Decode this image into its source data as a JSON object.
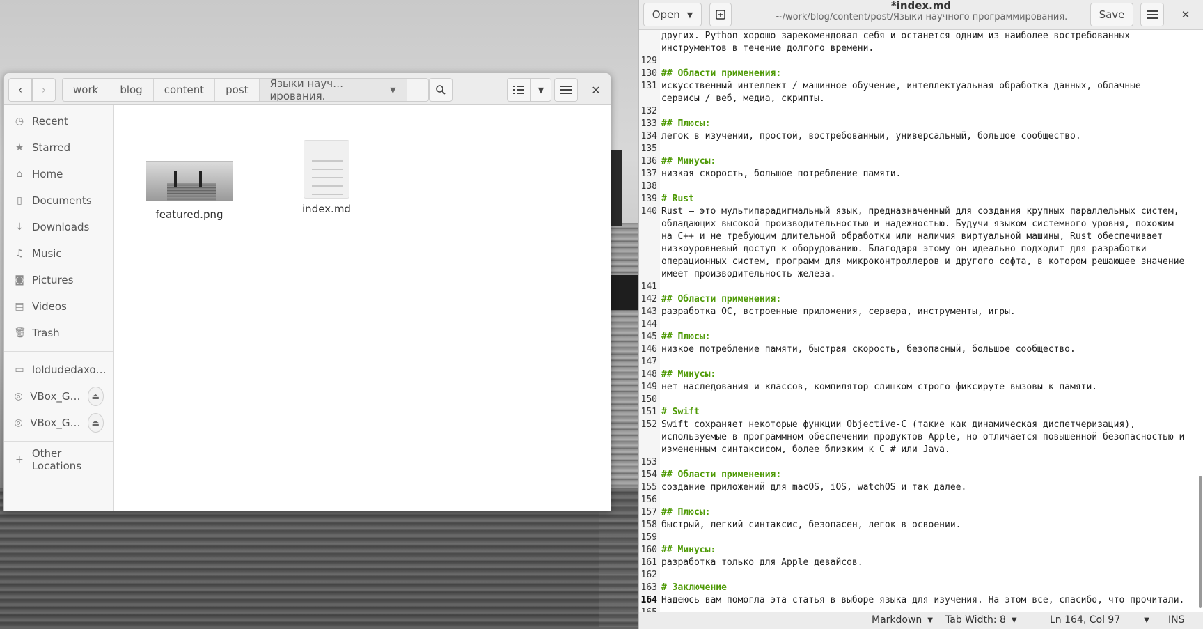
{
  "files": {
    "nav": {
      "back": "‹",
      "forward": "›"
    },
    "crumbs": [
      "work",
      "blog",
      "content",
      "post"
    ],
    "current_crumb": "Языки науч… ирования.",
    "sidebar": [
      {
        "label": "Recent",
        "icon": "◷"
      },
      {
        "label": "Starred",
        "icon": "★"
      },
      {
        "label": "Home",
        "icon": "⌂"
      },
      {
        "label": "Documents",
        "icon": "▯"
      },
      {
        "label": "Downloads",
        "icon": "↓"
      },
      {
        "label": "Music",
        "icon": "♫"
      },
      {
        "label": "Pictures",
        "icon": "◙"
      },
      {
        "label": "Videos",
        "icon": "▤"
      },
      {
        "label": "Trash",
        "icon": "🗑"
      }
    ],
    "devices": [
      {
        "label": "loldudedaxo…",
        "icon": "▭"
      },
      {
        "label": "VBox_G…",
        "icon": "◎"
      },
      {
        "label": "VBox_G…",
        "icon": "◎"
      }
    ],
    "other_locations": "Other Locations",
    "items": [
      {
        "name": "featured.png"
      },
      {
        "name": "index.md"
      }
    ]
  },
  "editor": {
    "open_label": "Open",
    "title": "*index.md",
    "subtitle": "~/work/blog/content/post/Языки научного программирования.",
    "save_label": "Save",
    "lines": [
      {
        "n": "",
        "t": "других. Python хорошо зарекомендовал себя и останется одним из наиболее востребованных",
        "h": false
      },
      {
        "n": "",
        "t": "инструментов в течение долгого времени.",
        "h": false
      },
      {
        "n": "129",
        "t": "",
        "h": false
      },
      {
        "n": "130",
        "t": "## Области применения:",
        "h": true
      },
      {
        "n": "131",
        "t": "искусственный интеллект / машинное обучение, интеллектуальная обработка данных, облачные",
        "h": false
      },
      {
        "n": "",
        "t": "сервисы / веб, медиа, скрипты.",
        "h": false
      },
      {
        "n": "132",
        "t": "",
        "h": false
      },
      {
        "n": "133",
        "t": "## Плюсы:",
        "h": true
      },
      {
        "n": "134",
        "t": "легок в изучении, простой, востребованный, универсальный, большое сообщество.",
        "h": false
      },
      {
        "n": "135",
        "t": "",
        "h": false
      },
      {
        "n": "136",
        "t": "## Минусы:",
        "h": true
      },
      {
        "n": "137",
        "t": "низкая скорость, большое потребление памяти.",
        "h": false
      },
      {
        "n": "138",
        "t": "",
        "h": false
      },
      {
        "n": "139",
        "t": "# Rust",
        "h": true
      },
      {
        "n": "140",
        "t": "Rust — это мультипарадигмальный язык, предназначенный для создания крупных параллельных систем,",
        "h": false
      },
      {
        "n": "",
        "t": "обладающих высокой производительностью и надежностью. Будучи языком системного уровня, похожим",
        "h": false
      },
      {
        "n": "",
        "t": "на C++ и не требующим длительной обработки или наличия виртуальной машины, Rust обеспечивает",
        "h": false
      },
      {
        "n": "",
        "t": "низкоуровневый доступ к оборудованию. Благодаря этому он идеально подходит для разработки",
        "h": false
      },
      {
        "n": "",
        "t": "операционных систем, программ для микроконтроллеров и другого софта, в котором решающее значение",
        "h": false
      },
      {
        "n": "",
        "t": "имеет производительность железа.",
        "h": false
      },
      {
        "n": "141",
        "t": "",
        "h": false
      },
      {
        "n": "142",
        "t": "## Области применения:",
        "h": true
      },
      {
        "n": "143",
        "t": "разработка ОС, встроенные приложения, сервера, инструменты, игры.",
        "h": false
      },
      {
        "n": "144",
        "t": "",
        "h": false
      },
      {
        "n": "145",
        "t": "## Плюсы:",
        "h": true
      },
      {
        "n": "146",
        "t": "низкое потребление памяти, быстрая скорость, безопасный, большое сообщество.",
        "h": false
      },
      {
        "n": "147",
        "t": "",
        "h": false
      },
      {
        "n": "148",
        "t": "## Минусы:",
        "h": true
      },
      {
        "n": "149",
        "t": "нет наследования и классов, компилятор слишком строго фиксируте вызовы к памяти.",
        "h": false
      },
      {
        "n": "150",
        "t": "",
        "h": false
      },
      {
        "n": "151",
        "t": "# Swift",
        "h": true
      },
      {
        "n": "152",
        "t": "Swift сохраняет некоторые функции Objective-C (такие как динамическая диспетчеризация),",
        "h": false
      },
      {
        "n": "",
        "t": "используемые в программном обеспечении продуктов Apple, но отличается повышенной безопасностью и",
        "h": false
      },
      {
        "n": "",
        "t": "измененным синтаксисом, более близким к C # или Java.",
        "h": false
      },
      {
        "n": "153",
        "t": "",
        "h": false
      },
      {
        "n": "154",
        "t": "## Области применения:",
        "h": true
      },
      {
        "n": "155",
        "t": "создание приложений для macOS, iOS, watchOS и так далее.",
        "h": false
      },
      {
        "n": "156",
        "t": "",
        "h": false
      },
      {
        "n": "157",
        "t": "## Плюсы:",
        "h": true
      },
      {
        "n": "158",
        "t": "быстрый, легкий синтаксис, безопасен, легок в освоении.",
        "h": false
      },
      {
        "n": "159",
        "t": "",
        "h": false
      },
      {
        "n": "160",
        "t": "## Минусы:",
        "h": true
      },
      {
        "n": "161",
        "t": "разработка только для Apple девайсов.",
        "h": false
      },
      {
        "n": "162",
        "t": "",
        "h": false
      },
      {
        "n": "163",
        "t": "# Заключение",
        "h": true
      },
      {
        "n": "164",
        "t": "Надеюсь вам помогла эта статья в выборе языка для изучения. На этом все, спасибо, что прочитали.",
        "h": false,
        "active": true
      },
      {
        "n": "165",
        "t": "",
        "h": false
      }
    ],
    "status": {
      "language": "Markdown",
      "tab_width": "Tab Width: 8",
      "position": "Ln 164, Col 97",
      "mode": "INS"
    }
  }
}
